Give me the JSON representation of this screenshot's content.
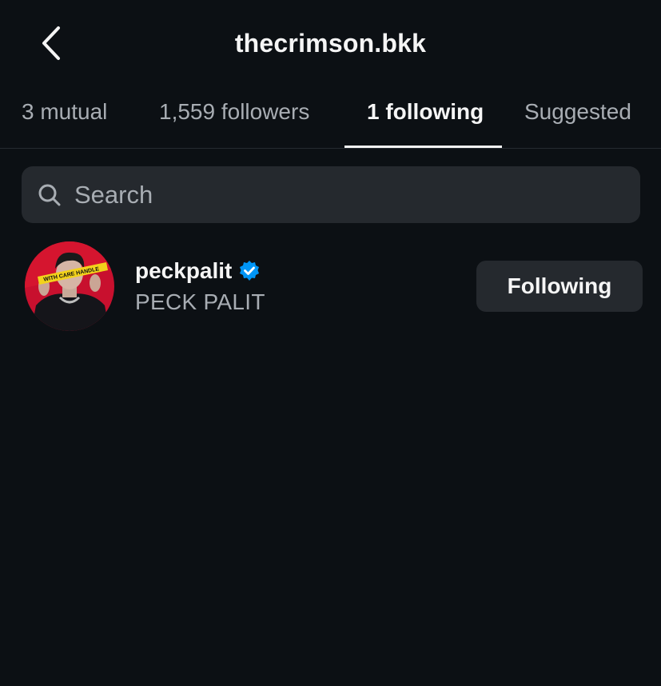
{
  "header": {
    "title": "thecrimson.bkk",
    "back_icon": "chevron-left-icon"
  },
  "tabs": [
    {
      "label": "3 mutual",
      "active": false
    },
    {
      "label": "1,559 followers",
      "active": false
    },
    {
      "label": "1 following",
      "active": true
    },
    {
      "label": "Suggested",
      "active": false
    }
  ],
  "search": {
    "placeholder": "Search",
    "value": "",
    "icon": "search-icon"
  },
  "users": [
    {
      "username": "peckpalit",
      "full_name": "PECK PALIT",
      "verified": true,
      "avatar_tape_text": "WITH CARE  HANDLE",
      "button_label": "Following"
    }
  ],
  "colors": {
    "background": "#0c1014",
    "primary_text": "#f5f5f5",
    "secondary_text": "#a8adb3",
    "surface": "#25292e",
    "verified_blue": "#0095f6",
    "avatar_red": "#c8102e",
    "tape_yellow": "#f2d21b"
  }
}
